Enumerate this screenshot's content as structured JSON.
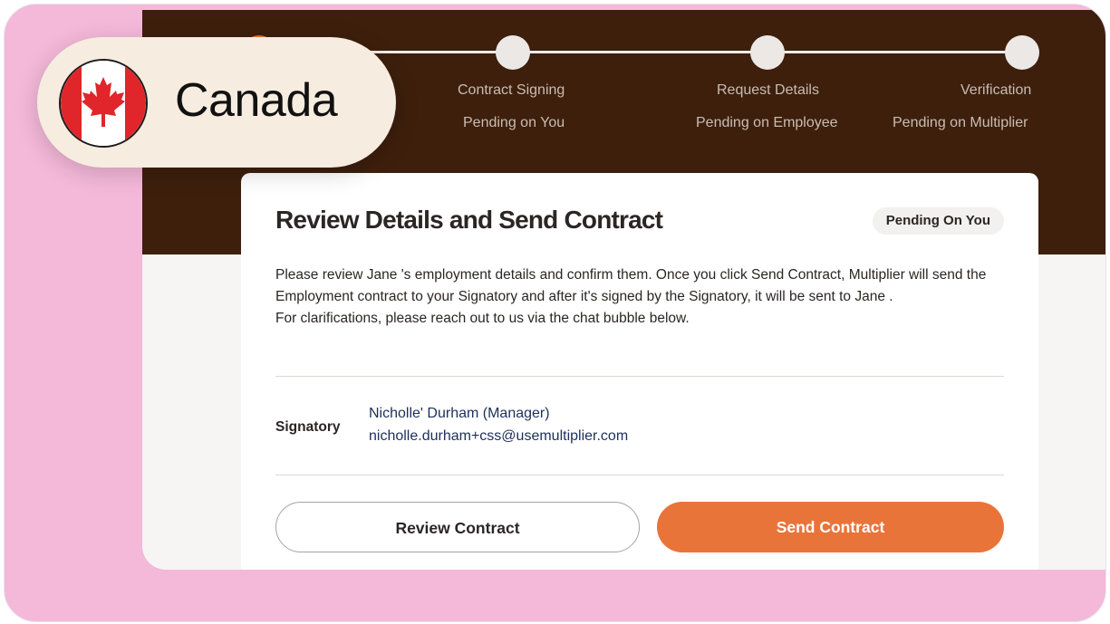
{
  "country": {
    "name": "Canada",
    "flag_icon": "canada-flag-icon"
  },
  "stepper": {
    "steps": [
      {
        "title": "Contract Signing",
        "status": "Pending on You"
      },
      {
        "title": "Request Details",
        "status": "Pending on Employee"
      },
      {
        "title": "Verification",
        "status": "Pending on Multiplier"
      }
    ]
  },
  "card": {
    "title": "Review Details and Send Contract",
    "status_badge": "Pending On You",
    "description": "Please review Jane 's employment details and confirm them. Once you click Send Contract, Multiplier will send the Employment contract to your Signatory and after it's signed by the Signatory, it will be sent to Jane .",
    "clarification": "For clarifications, please reach out to us via the chat bubble below.",
    "signatory": {
      "label": "Signatory",
      "name": "Nicholle' Durham (Manager)",
      "email": "nicholle.durham+css@usemultiplier.com"
    },
    "review_button": "Review Contract",
    "send_button": "Send Contract"
  },
  "colors": {
    "brand_dark": "#3d1f0c",
    "accent": "#e8743a",
    "frame_pink": "#f4b8d9",
    "pill_bg": "#f6ecdf",
    "link": "#1d2f5c"
  }
}
